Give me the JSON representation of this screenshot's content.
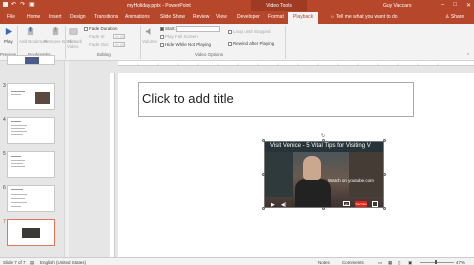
{
  "titlebar": {
    "doc_title": "myHoliday.pptx - PowerPoint",
    "context_tools": "Video Tools",
    "user": "Guy Vaccaro",
    "window_controls": [
      "–",
      "□",
      "✕"
    ]
  },
  "tabs": {
    "file": "File",
    "items": [
      "Home",
      "Insert",
      "Design",
      "Transitions",
      "Animations",
      "Slide Show",
      "Review",
      "View",
      "Developer",
      "Format",
      "Playback"
    ],
    "active": "Playback",
    "tell_me": "Tell me what you want to do",
    "share": "Share"
  },
  "ribbon": {
    "preview": {
      "play": "Play",
      "group": "Preview"
    },
    "bookmarks": {
      "add": "Add Bookmark",
      "remove": "Remove Bookmark",
      "group": "Bookmarks"
    },
    "editing": {
      "trim": "Trim Video",
      "fade_duration": "Fade Duration",
      "fade_in": "Fade In:",
      "fade_out": "Fade Out:",
      "fade_in_value": "00.00",
      "fade_out_value": "00.00",
      "group": "Editing"
    },
    "video_options": {
      "volume": "Volume",
      "start_label": "Start:",
      "play_full_screen": "Play Full Screen",
      "hide_while_not_playing": "Hide While Not Playing",
      "loop": "Loop until Stopped",
      "rewind": "Rewind after Playing",
      "group": "Video Options"
    }
  },
  "thumbnails": [
    {
      "number": "3",
      "selected": false
    },
    {
      "number": "4",
      "selected": false
    },
    {
      "number": "5",
      "selected": false
    },
    {
      "number": "6",
      "selected": false
    },
    {
      "number": "7",
      "selected": true
    }
  ],
  "slide": {
    "title_placeholder": "Click to add title",
    "video": {
      "title": "Visit Venice - 5 Vital Tips for Visiting V",
      "watch_on": "Watch on youtube.com",
      "play_icon": "▶",
      "volume_icon": "◀)",
      "brand": "YouTube"
    }
  },
  "statusbar": {
    "slide_info": "Slide 7 of 7",
    "language": "English (United States)",
    "notes": "Notes",
    "comments": "Comments",
    "zoom": "47%"
  },
  "colors": {
    "brand": "#b7472a",
    "selected_border": "#e0775a"
  }
}
